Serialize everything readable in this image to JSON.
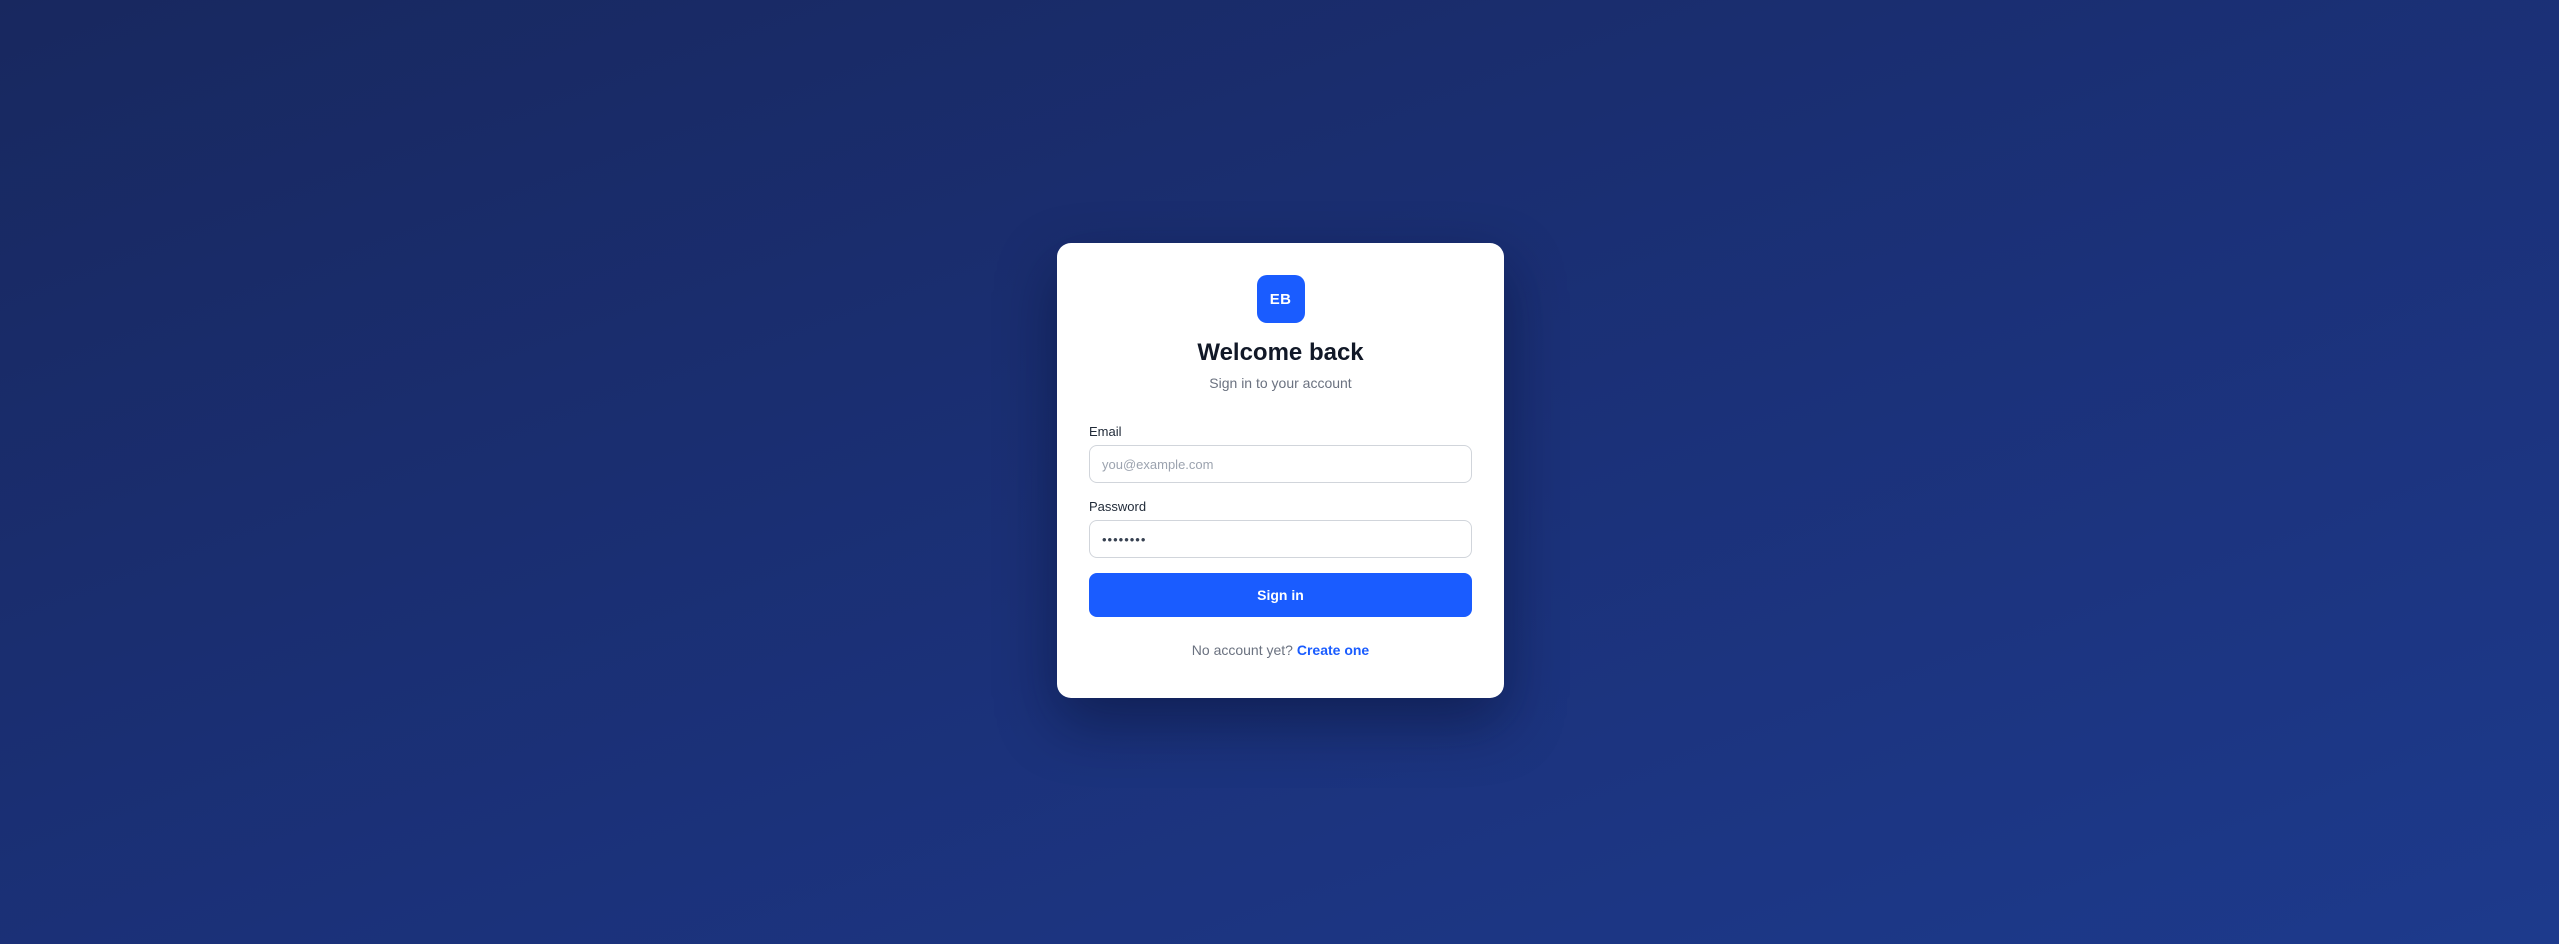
{
  "logo": {
    "initials": "EB",
    "color": "#1a5cff"
  },
  "header": {
    "title": "Welcome back",
    "subtitle": "Sign in to your account"
  },
  "form": {
    "email": {
      "label": "Email",
      "placeholder": "you@example.com",
      "value": ""
    },
    "password": {
      "label": "Password",
      "value": "••••••••"
    },
    "submit_label": "Sign in"
  },
  "footer": {
    "prompt": "No account yet?",
    "link_label": "Create one"
  },
  "colors": {
    "accent": "#1a5cff",
    "background_start": "#18285f",
    "background_end": "#1d3a8c"
  }
}
